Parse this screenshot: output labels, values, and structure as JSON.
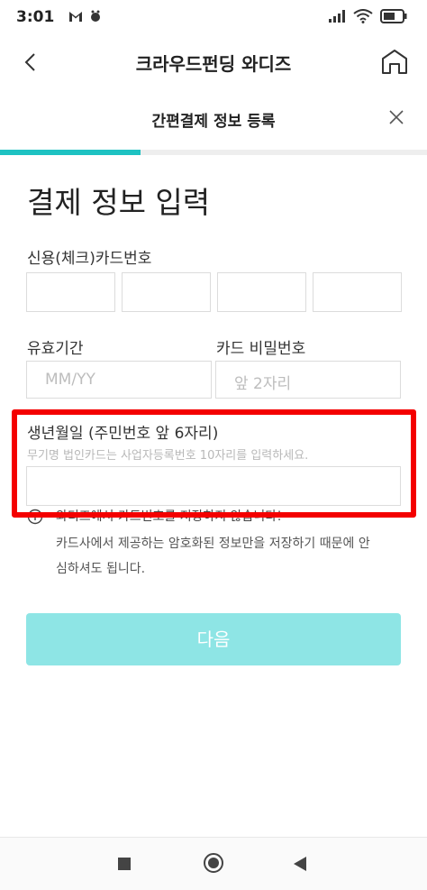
{
  "status": {
    "time": "3:01",
    "left_icons": [
      "gmail-icon",
      "bug-icon"
    ],
    "right_icons": [
      "signal-icon",
      "wifi-icon",
      "battery-icon"
    ]
  },
  "appbar": {
    "title": "크라우드펀딩 와디즈"
  },
  "subheader": {
    "title": "간편결제 정보 등록"
  },
  "progress": {
    "fraction": 0.33
  },
  "main": {
    "heading": "결제 정보 입력",
    "card_number_label": "신용(체크)카드번호",
    "expiry_label": "유효기간",
    "expiry_placeholder": "MM/YY",
    "pin_label": "카드 비밀번호",
    "pin_placeholder": "앞 2자리",
    "birth_label": "생년월일 (주민번호 앞 6자리)",
    "birth_hint": "무기명 법인카드는 사업자등록번호 10자리를 입력하세요.",
    "notice_line1": "와디즈에서 카드번호를 저장하지 않습니다!",
    "notice_line2": "카드사에서 제공하는 암호화된 정보만을 저장하기 때문에 안",
    "notice_line3": "심하셔도 됩니다.",
    "next_button": "다음"
  },
  "colors": {
    "accent": "#1ec2c2",
    "button_disabled": "#8ee5e5",
    "highlight": "#f40000"
  }
}
